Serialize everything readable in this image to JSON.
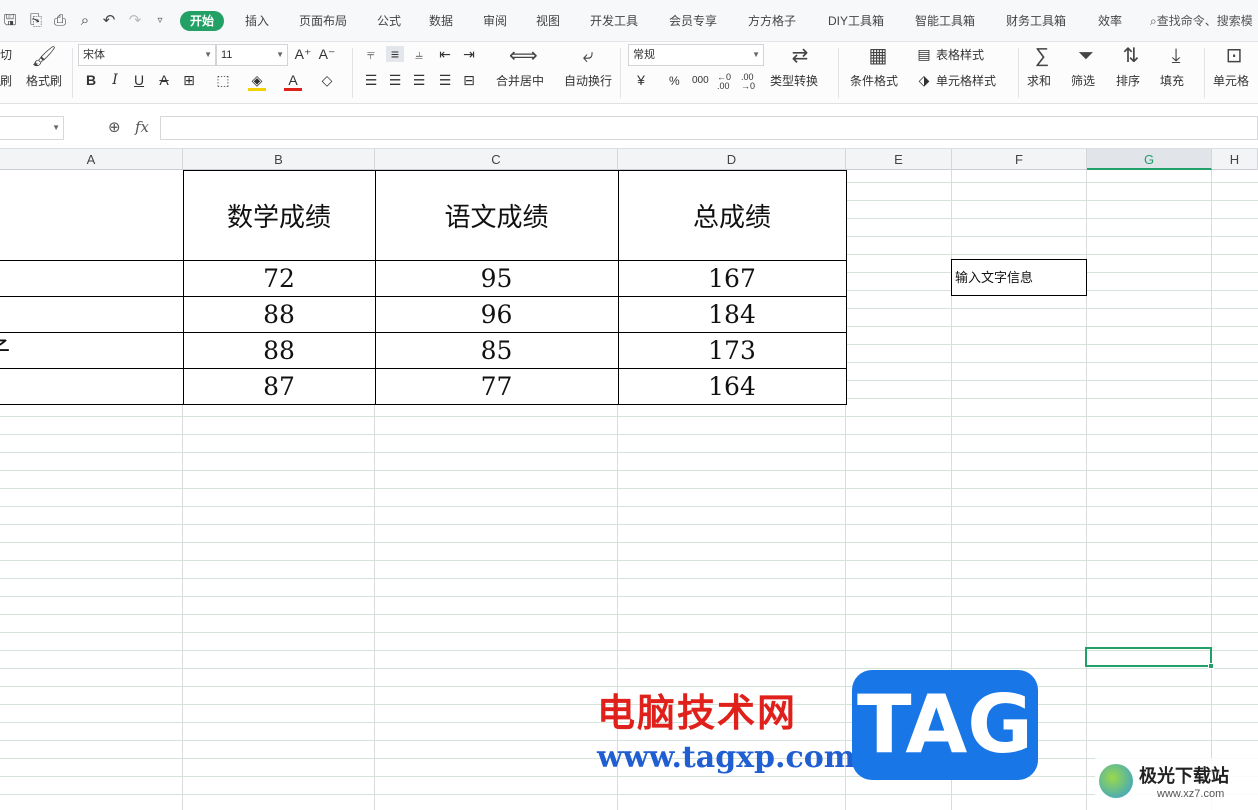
{
  "quick_access": [
    "save-icon",
    "export-icon",
    "print-icon",
    "preview-icon",
    "undo-icon",
    "redo-icon",
    "more-icon"
  ],
  "menu_tabs": [
    "开始",
    "插入",
    "页面布局",
    "公式",
    "数据",
    "审阅",
    "视图",
    "开发工具",
    "会员专享",
    "方方格子",
    "DIY工具箱",
    "智能工具箱",
    "财务工具箱",
    "效率"
  ],
  "search_label": "查找命令、搜索模",
  "ribbon": {
    "cut": "切",
    "brush_left": "刷",
    "format_painter": "格式刷",
    "font_name": "宋体",
    "font_size": "11",
    "merge_center": "合并居中",
    "auto_wrap": "自动换行",
    "number_format": "常规",
    "type_convert": "类型转换",
    "cond_format": "条件格式",
    "table_style": "表格样式",
    "cell_style": "单元格样式",
    "sum": "求和",
    "filter": "筛选",
    "sort": "排序",
    "fill": "填充",
    "cell": "单元格",
    "percent": "%",
    "thousands": "000",
    "dec_inc": "←0 .00",
    "dec_dec": ".00 →0"
  },
  "formula_bar": {
    "fx": "fx",
    "name_box": ""
  },
  "columns": [
    "A",
    "B",
    "C",
    "D",
    "E",
    "F",
    "G",
    "H"
  ],
  "selected_column": "G",
  "table": {
    "headers": [
      "数学成绩",
      "语文成绩",
      "总成绩"
    ],
    "rows": [
      {
        "a": "",
        "math": "72",
        "chinese": "95",
        "total": "167"
      },
      {
        "a": "",
        "math": "88",
        "chinese": "96",
        "total": "184"
      },
      {
        "a": "子",
        "math": "88",
        "chinese": "85",
        "total": "173"
      },
      {
        "a": "",
        "math": "87",
        "chinese": "77",
        "total": "164"
      }
    ]
  },
  "f_cell_text": "输入文字信息",
  "watermark": {
    "cn_text": "电脑技术网",
    "url": "www.tagxp.com",
    "tag": "TAG",
    "site2_name": "极光下载站",
    "site2_url": "www.xz7.com"
  },
  "colors": {
    "accent": "#23a066",
    "watermark_red": "#e0201a",
    "watermark_blue": "#1976e6"
  }
}
